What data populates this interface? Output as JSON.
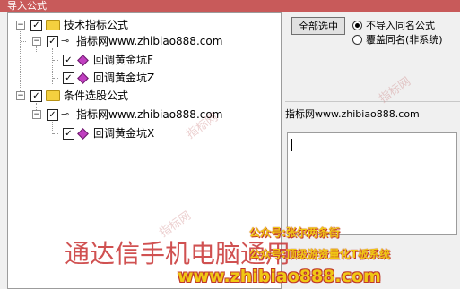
{
  "window": {
    "title": "导入公式"
  },
  "tree": {
    "groups": [
      {
        "label": "技术指标公式",
        "checked": true,
        "source": {
          "label": "指标网www.zhibiao888.com",
          "checked": true
        },
        "items": [
          {
            "label": "回调黄金坑F",
            "checked": true
          },
          {
            "label": "回调黄金坑Z",
            "checked": true
          }
        ]
      },
      {
        "label": "条件选股公式",
        "checked": true,
        "source": {
          "label": "指标网www.zhibiao888.com",
          "checked": true
        },
        "items": [
          {
            "label": "回调黄金坑X",
            "checked": true
          }
        ]
      }
    ]
  },
  "panel": {
    "select_all_label": "全部选中",
    "options": [
      {
        "label": "不导入同名公式",
        "selected": true
      },
      {
        "label": "覆盖同名(非系统)",
        "selected": false
      }
    ],
    "source_name": "指标网www.zhibiao888.com",
    "description": ""
  },
  "watermarks": {
    "big": "通达信手机电脑通用",
    "line1": "公众号:张尔两条街",
    "line2": "公众号:顶级游资量化T板系统",
    "url": "www.zhibiao888.com",
    "faint": "指标网"
  }
}
